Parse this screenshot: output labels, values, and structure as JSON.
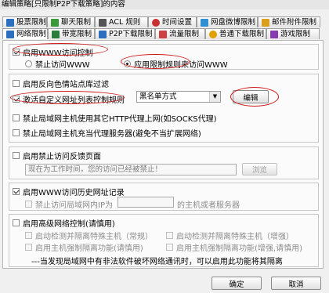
{
  "window": {
    "title": "编辑策略[只限制P2P下载策略]的内容"
  },
  "tabs_row1": [
    {
      "label": "股票限制",
      "icon": "stock-icon",
      "color": "#2c6fbf"
    },
    {
      "label": "聊天限制",
      "icon": "chat-icon",
      "color": "#3a9a3a"
    },
    {
      "label": "ACL 规则",
      "icon": "acl-icon",
      "color": "#555555"
    },
    {
      "label": "时间设置",
      "icon": "clock-icon",
      "color": "#c83030"
    },
    {
      "label": "网盘微博限制",
      "icon": "cloud-icon",
      "color": "#2f8fd0"
    },
    {
      "label": "邮件附件限制",
      "icon": "mail-icon",
      "color": "#d9a020"
    }
  ],
  "tabs_row2": [
    {
      "label": "网络限制",
      "icon": "network-icon",
      "color": "#2c6fbf"
    },
    {
      "label": "带宽限制",
      "icon": "bandwidth-icon",
      "color": "#2a7d3a"
    },
    {
      "label": "P2P下载限制",
      "icon": "p2p-icon",
      "color": "#2c6fbf"
    },
    {
      "label": "流量限制",
      "icon": "traffic-icon",
      "color": "#d04040"
    },
    {
      "label": "普通下载限制",
      "icon": "download-icon",
      "color": "#e0a000"
    },
    {
      "label": "游戏限制",
      "icon": "game-icon",
      "color": "#8a3ab0"
    }
  ],
  "www": {
    "enable_label": "启用WWW访问控制",
    "radio_forbid": "禁止访问WWW",
    "radio_rules": "应用限制规则来访问WWW"
  },
  "options": {
    "reverse_proxy": "启用反向色情站点库过滤",
    "url_list": "激活自定义网址列表控制规则",
    "blacklist_value": "黑名单方式",
    "edit_button": "编辑",
    "http_proxy": "禁止局域网主机使用其它HTTP代理上网(如SOCKS代理)",
    "proxy_server": "禁止局域网主机充当代理服务器(避免不当扩展网络)"
  },
  "feedback": {
    "label": "启用禁止访问反馈页面",
    "text": "现在为工作时间，您的访问已经被禁止！",
    "browse": "浏览"
  },
  "history": {
    "label": "启用WWW访问历史网址记录",
    "sub_label": "禁止访问局域网内IP为",
    "sub_suffix": "的主机或者服务器"
  },
  "advanced": {
    "label": "启用高级网络控制(请慎用)",
    "opt1": "启动检测并隔离特殊主机（常规）",
    "opt2": "启动检测并隔离特殊主机（增强）",
    "opt3": "启用主机强制隔离功能(请慎用)",
    "opt4": "启用主机强制隔离功能(增强,请慎用)",
    "note": "---当发现局域网中有非法软件破坏网络通讯时，可以启用此功能将其隔离"
  },
  "footer": {
    "ok": "确定",
    "cancel": "取消"
  }
}
